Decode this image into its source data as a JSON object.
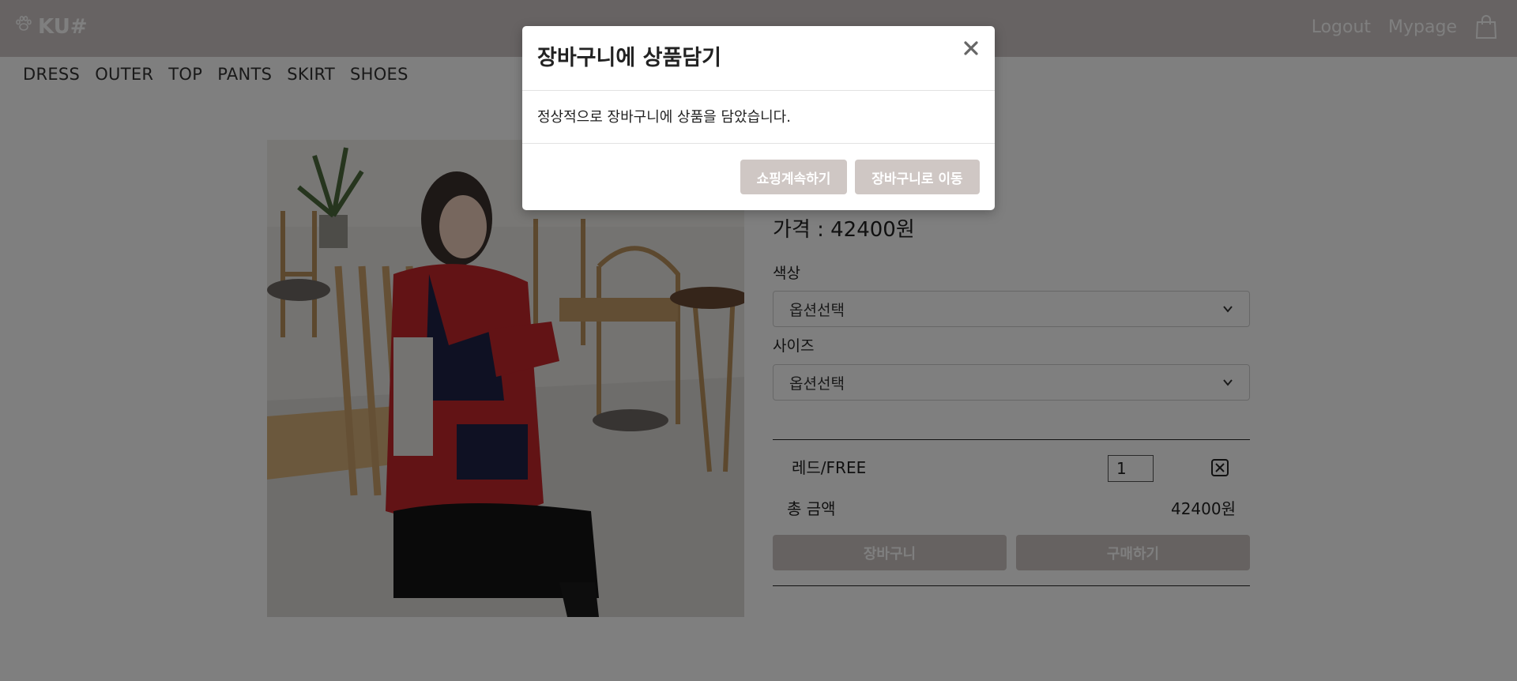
{
  "header": {
    "logo_text": "KU#",
    "logout_label": "Logout",
    "mypage_label": "Mypage"
  },
  "nav": {
    "items": [
      "DRESS",
      "OUTER",
      "TOP",
      "PANTS",
      "SKIRT",
      "SHOES"
    ]
  },
  "product": {
    "price_label": "가격 : 42400원",
    "color_label": "색상",
    "color_selected": "옵션선택",
    "size_label": "사이즈",
    "size_selected": "옵션선택",
    "cart_item_name": "레드/FREE",
    "cart_item_qty": "1",
    "total_label": "총 금액",
    "total_value": "42400원",
    "cart_button": "장바구니",
    "buy_button": "구매하기"
  },
  "modal": {
    "title": "장바구니에 상품담기",
    "message": "정상적으로 장바구니에 상품을 담았습니다.",
    "continue_button": "쇼핑계속하기",
    "go_cart_button": "장바구니로 이동"
  }
}
